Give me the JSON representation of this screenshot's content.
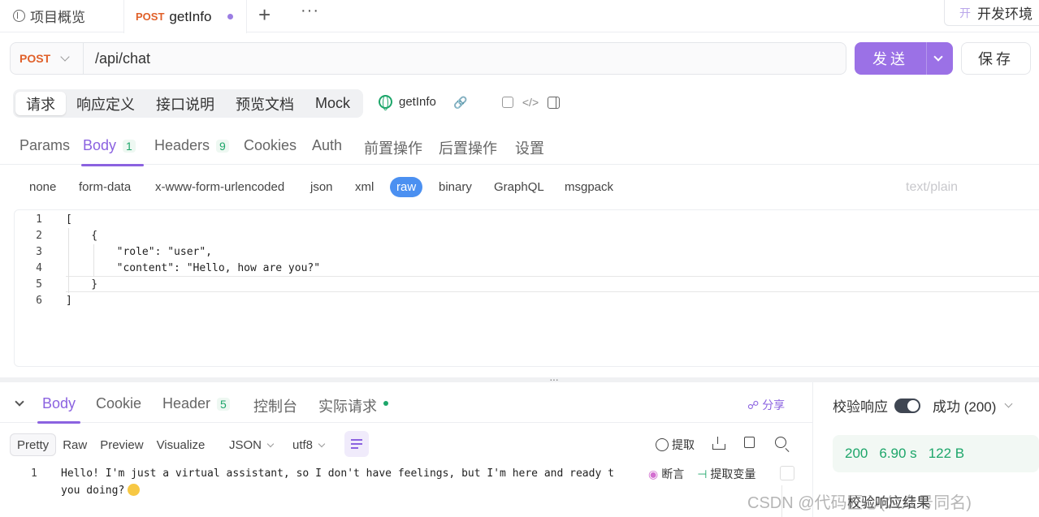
{
  "tabs": {
    "overview": "项目概览",
    "active_method": "POST",
    "active_name": "getInfo",
    "plus": "+",
    "more": "···"
  },
  "environment": {
    "icon_char": "开",
    "label": "开发环境"
  },
  "request": {
    "method": "POST",
    "url": "/api/chat",
    "send_label": "发送",
    "save_label": "保存"
  },
  "subtabs": [
    "请求",
    "响应定义",
    "接口说明",
    "预览文档",
    "Mock"
  ],
  "doc_name": "getInfo",
  "req_tabs": {
    "params": "Params",
    "body": "Body",
    "body_count": "1",
    "headers": "Headers",
    "headers_count": "9",
    "cookies": "Cookies",
    "auth": "Auth",
    "pre": "前置操作",
    "post": "后置操作",
    "settings": "设置"
  },
  "body_types": [
    "none",
    "form-data",
    "x-www-form-urlencoded",
    "json",
    "xml",
    "raw",
    "binary",
    "GraphQL",
    "msgpack"
  ],
  "body_type_active": "raw",
  "content_type": "text/plain",
  "editor_lines": [
    {
      "n": "1",
      "code": "["
    },
    {
      "n": "2",
      "code": "    {"
    },
    {
      "n": "3",
      "code": "        \"role\": \"user\","
    },
    {
      "n": "4",
      "code": "        \"content\": \"Hello, how are you?\""
    },
    {
      "n": "5",
      "code": "    }"
    },
    {
      "n": "6",
      "code": "]"
    }
  ],
  "response": {
    "tabs": {
      "body": "Body",
      "cookie": "Cookie",
      "header": "Header",
      "header_count": "5",
      "console": "控制台",
      "actual": "实际请求"
    },
    "share": "分享",
    "formats": [
      "Pretty",
      "Raw",
      "Preview",
      "Visualize"
    ],
    "format_active": "Pretty",
    "lang": "JSON",
    "encoding": "utf8",
    "extract": "提取",
    "line_no": "1",
    "line1": "Hello! I'm just a virtual assistant, so I don't have feelings, but I'm here and ready t",
    "line2": "you doing?",
    "assert": "断言",
    "extract_var": "提取变量"
  },
  "verify": {
    "label": "校验响应",
    "status": "成功 (200)",
    "code": "200",
    "time": "6.90 s",
    "size": "122 B",
    "result": "校验响应结果"
  },
  "watermark": "CSDN @代码匠心(公众号同名)",
  "colors": {
    "accent": "#8b62e0",
    "send": "#9b71e6",
    "method": "#e06029",
    "success": "#1da66a",
    "raw_pill": "#4b90f1"
  }
}
